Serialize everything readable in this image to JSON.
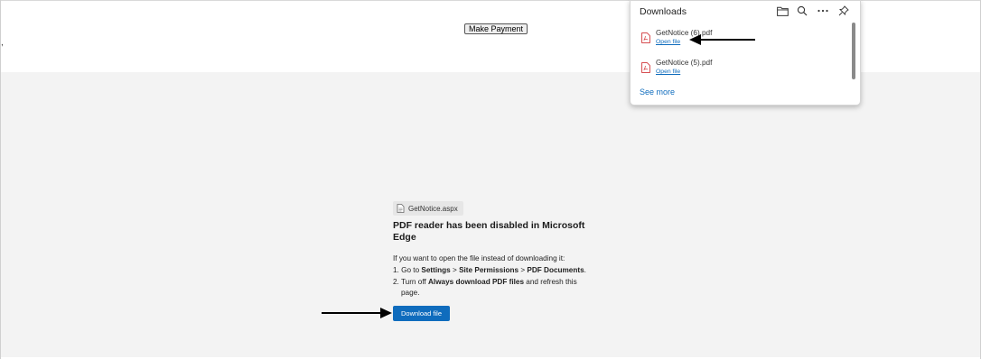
{
  "page": {
    "comma": ",",
    "make_payment_label": "Make Payment"
  },
  "pdf_viewer": {
    "file_name": "GetNotice.aspx",
    "title": "PDF reader has been disabled in Microsoft Edge",
    "intro": "If you want to open the file instead of downloading it:",
    "step1": {
      "prefix": "1. Go to ",
      "settings": "Settings",
      "sep1": " > ",
      "site_permissions": "Site Permissions",
      "sep2": " > ",
      "pdf_documents": "PDF Documents",
      "suffix": "."
    },
    "step2": {
      "prefix": "2. Turn off ",
      "bold": "Always download PDF files",
      "suffix": " and refresh this",
      "continuation": "page."
    },
    "download_button_label": "Download file"
  },
  "downloads_panel": {
    "title": "Downloads",
    "icons": [
      "folder-icon",
      "search-icon",
      "more-icon",
      "pin-icon"
    ],
    "items": [
      {
        "file_name": "GetNotice (6).pdf",
        "action": "Open file"
      },
      {
        "file_name": "GetNotice (5).pdf",
        "action": "Open file"
      }
    ],
    "see_more": "See more"
  },
  "colors": {
    "accent": "#0f6cbd",
    "pdf_background": "#f3f3f3",
    "pdf_icon": "#d13438"
  }
}
